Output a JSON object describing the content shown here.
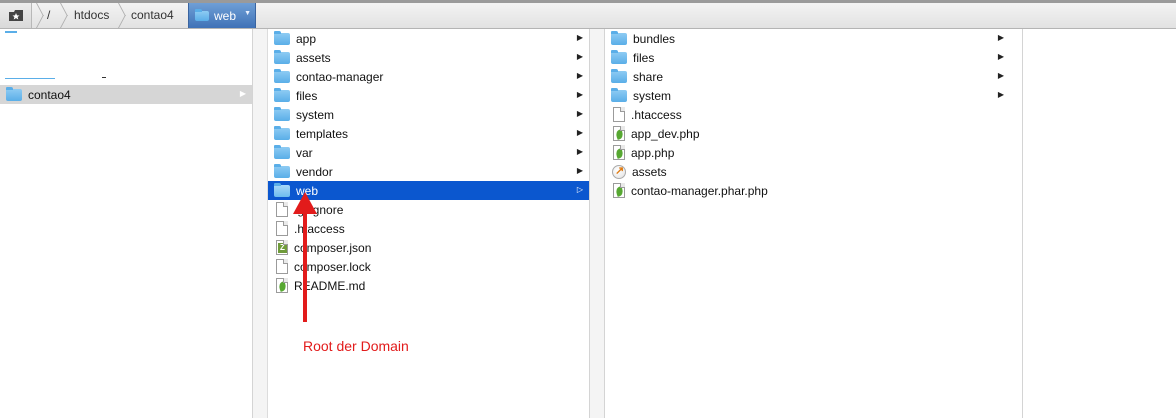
{
  "breadcrumb": {
    "home_icon": "favorites-star-icon",
    "items": [
      "/",
      "htdocs",
      "contao4"
    ],
    "active": "web"
  },
  "column1": {
    "items": [
      {
        "name": "contao4",
        "icon": "folder-icon",
        "state": "open"
      }
    ]
  },
  "column2": {
    "items": [
      {
        "name": "app",
        "icon": "folder-icon",
        "folder": true
      },
      {
        "name": "assets",
        "icon": "folder-icon",
        "folder": true
      },
      {
        "name": "contao-manager",
        "icon": "folder-icon",
        "folder": true
      },
      {
        "name": "files",
        "icon": "folder-icon",
        "folder": true
      },
      {
        "name": "system",
        "icon": "folder-icon",
        "folder": true
      },
      {
        "name": "templates",
        "icon": "folder-icon",
        "folder": true
      },
      {
        "name": "var",
        "icon": "folder-icon",
        "folder": true
      },
      {
        "name": "vendor",
        "icon": "folder-icon",
        "folder": true
      },
      {
        "name": "web",
        "icon": "folder-icon",
        "folder": true,
        "selected": true
      },
      {
        "name": ".gitignore",
        "icon": "document-icon"
      },
      {
        "name": ".htaccess",
        "icon": "document-icon"
      },
      {
        "name": "composer.json",
        "icon": "json-file-icon"
      },
      {
        "name": "composer.lock",
        "icon": "document-icon"
      },
      {
        "name": "README.md",
        "icon": "leaf-file-icon"
      }
    ]
  },
  "column3": {
    "items": [
      {
        "name": "bundles",
        "icon": "folder-icon",
        "folder": true
      },
      {
        "name": "files",
        "icon": "folder-icon",
        "folder": true
      },
      {
        "name": "share",
        "icon": "folder-icon",
        "folder": true
      },
      {
        "name": "system",
        "icon": "folder-icon",
        "folder": true
      },
      {
        "name": ".htaccess",
        "icon": "document-icon"
      },
      {
        "name": "app_dev.php",
        "icon": "leaf-file-icon"
      },
      {
        "name": "app.php",
        "icon": "leaf-file-icon"
      },
      {
        "name": "assets",
        "icon": "alias-icon"
      },
      {
        "name": "contao-manager.phar.php",
        "icon": "leaf-file-icon"
      }
    ]
  },
  "annotation": {
    "text": "Root der Domain",
    "color": "#e21b1b"
  },
  "colors": {
    "selection": "#0b57cf",
    "folder": "#5aaee8"
  }
}
